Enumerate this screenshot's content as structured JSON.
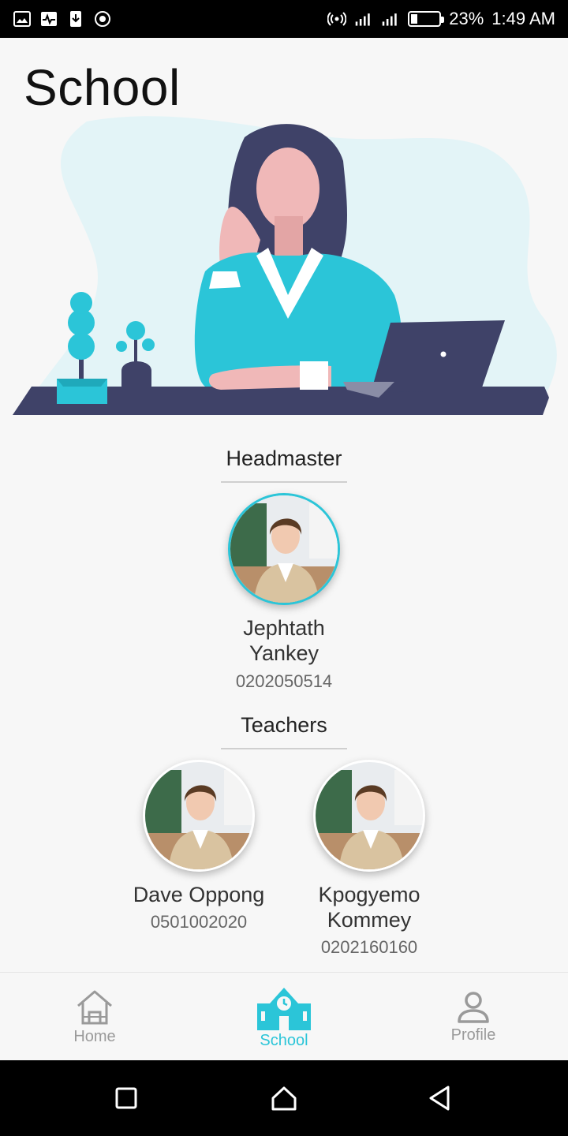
{
  "status_bar": {
    "left_icons": [
      "gallery-icon",
      "activity-icon",
      "download-icon",
      "record-icon"
    ],
    "right_icons": [
      "hotspot-icon",
      "signal-icon",
      "signal-icon",
      "battery-icon"
    ],
    "battery_percent": "23%",
    "time": "1:49 AM"
  },
  "page": {
    "title": "School"
  },
  "headmaster": {
    "section_title": "Headmaster",
    "name_line1": "Jephtath",
    "name_line2": "Yankey",
    "phone": "0202050514"
  },
  "teachers": {
    "section_title": "Teachers",
    "items": [
      {
        "name_line1": "Dave Oppong",
        "name_line2": "",
        "phone": "0501002020"
      },
      {
        "name_line1": "Kpogyemo",
        "name_line2": "Kommey",
        "phone": "0202160160"
      }
    ]
  },
  "bottom_nav": {
    "items": [
      {
        "label": "Home",
        "icon": "home-icon",
        "active": false
      },
      {
        "label": "School",
        "icon": "school-icon",
        "active": true
      },
      {
        "label": "Profile",
        "icon": "profile-icon",
        "active": false
      }
    ]
  },
  "colors": {
    "accent": "#2bc5d8",
    "background": "#f7f7f7",
    "inactive": "#9a9a9a"
  }
}
